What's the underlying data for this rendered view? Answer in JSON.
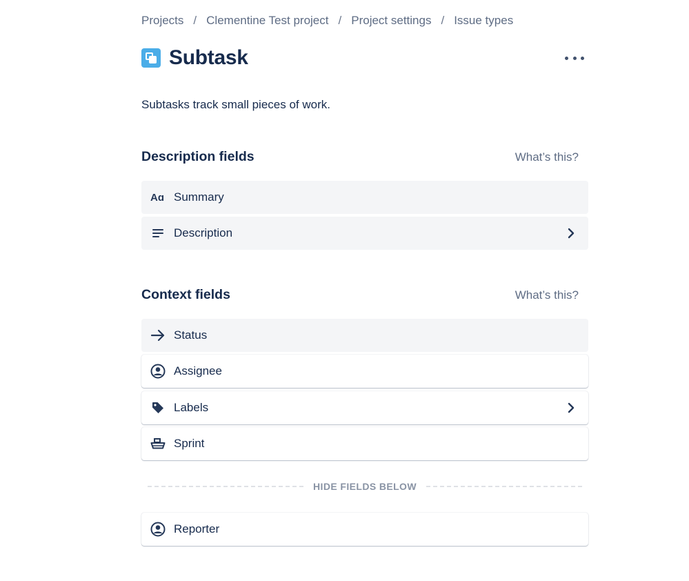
{
  "breadcrumb": {
    "items": [
      "Projects",
      "Clementine Test project",
      "Project settings",
      "Issue types"
    ],
    "separator": "/"
  },
  "page": {
    "title": "Subtask",
    "description": "Subtasks track small pieces of work.",
    "issue_icon": "subtask-icon",
    "issue_icon_color": "#4bade8"
  },
  "description_section": {
    "title": "Description fields",
    "help_link": "What’s this?",
    "fields": [
      {
        "label": "Summary",
        "icon": "text-icon",
        "expandable": false
      },
      {
        "label": "Description",
        "icon": "paragraph-icon",
        "expandable": true
      }
    ]
  },
  "context_section": {
    "title": "Context fields",
    "help_link": "What’s this?",
    "fields": [
      {
        "label": "Status",
        "icon": "arrow-right-icon",
        "expandable": false
      },
      {
        "label": "Assignee",
        "icon": "person-icon",
        "expandable": false
      },
      {
        "label": "Labels",
        "icon": "tag-icon",
        "expandable": true
      },
      {
        "label": "Sprint",
        "icon": "ship-icon",
        "expandable": false
      }
    ],
    "hide_divider": "HIDE FIELDS BELOW",
    "hidden_fields": [
      {
        "label": "Reporter",
        "icon": "person-icon",
        "expandable": false
      }
    ]
  }
}
